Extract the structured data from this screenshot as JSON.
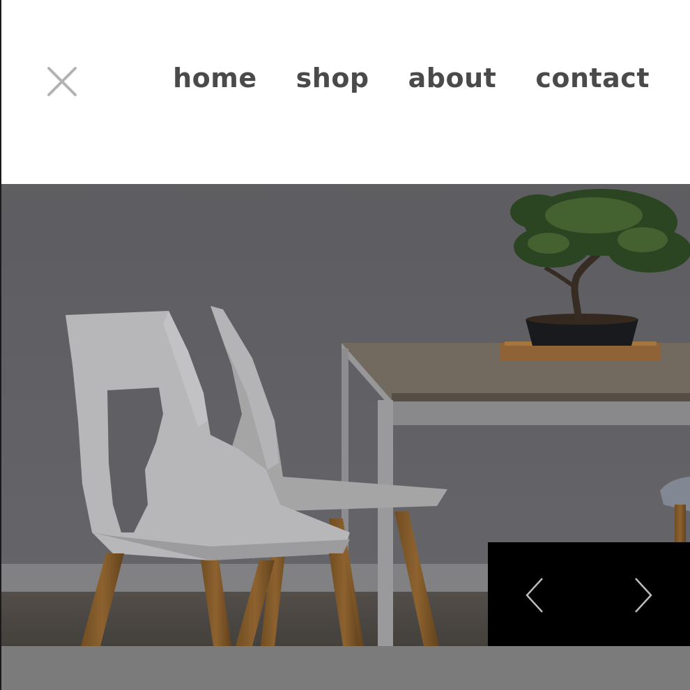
{
  "nav": {
    "close_icon": "close-icon",
    "items": [
      {
        "label": "home"
      },
      {
        "label": "shop"
      },
      {
        "label": "about"
      },
      {
        "label": "contact"
      }
    ]
  },
  "hero": {
    "image_subject": "",
    "controls": {
      "prev_icon": "chevron-left-icon",
      "next_icon": "chevron-right-icon"
    }
  },
  "colors": {
    "nav_text": "#4a4a4a",
    "close_icon": "#b3b3b3",
    "controls_bg": "#000000",
    "bottom_strip": "#7b7b7b"
  }
}
